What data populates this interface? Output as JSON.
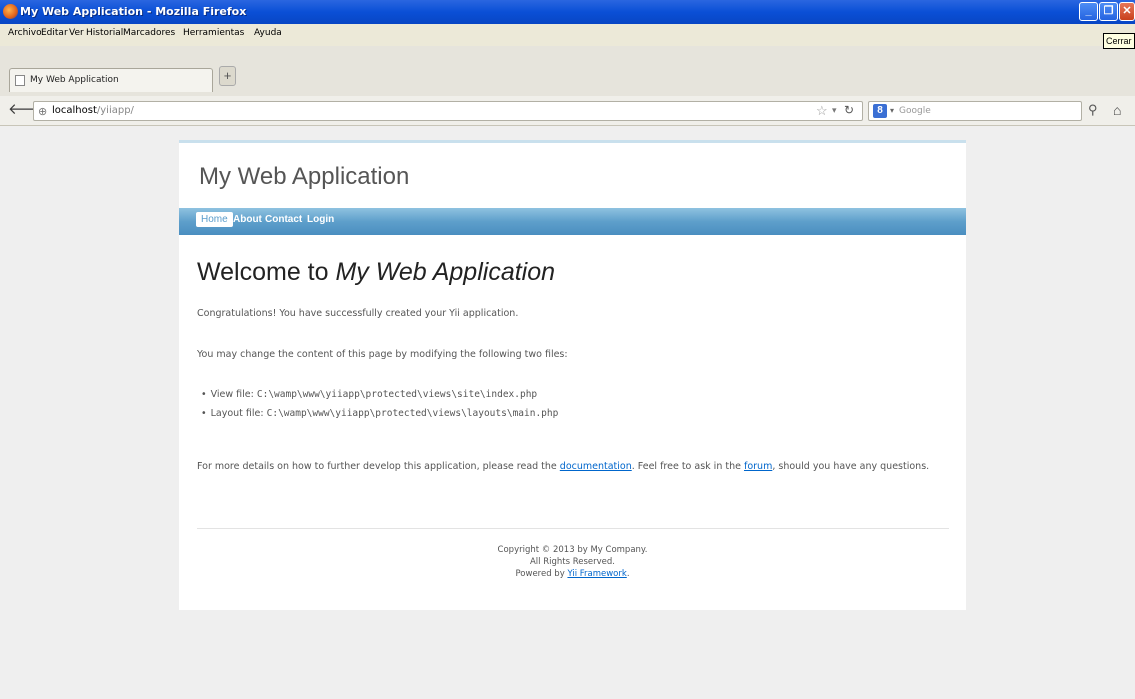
{
  "window": {
    "title": "My Web Application - Mozilla Firefox",
    "close_tooltip": "Cerrar"
  },
  "menubar": {
    "items": [
      "Archivo",
      "Editar",
      "Ver",
      "Historial",
      "Marcadores",
      "Herramientas",
      "Ayuda"
    ]
  },
  "tabs": {
    "active_label": "My Web Application",
    "new_tab": "+"
  },
  "nav": {
    "url_host": "localhost",
    "url_path": "/yiiapp/",
    "search_placeholder": "Google",
    "search_engine_letter": "8"
  },
  "site": {
    "title": "My Web Application",
    "menu": [
      "Home",
      "About",
      "Contact",
      "Login"
    ],
    "heading_prefix": "Welcome to ",
    "heading_emphasis": "My Web Application",
    "congrats": "Congratulations! You have successfully created your Yii application.",
    "change_intro": "You may change the content of this page by modifying the following two files:",
    "view_label": "View file: ",
    "view_path": "C:\\wamp\\www\\yiiapp\\protected\\views\\site\\index.php",
    "layout_label": "Layout file: ",
    "layout_path": "C:\\wamp\\www\\yiiapp\\protected\\views\\layouts\\main.php",
    "more_prefix": "For more details on how to further develop this application, please read the ",
    "documentation_link": "documentation",
    "more_middle": ". Feel free to ask in the ",
    "forum_link": "forum",
    "more_suffix": ", should you have any questions.",
    "footer_copyright": "Copyright © 2013 by My Company.",
    "footer_rights": "All Rights Reserved.",
    "footer_powered": "Powered by ",
    "footer_framework_link": "Yii Framework",
    "footer_period": "."
  },
  "colors": {
    "titlebar": "#0a4fd6",
    "menu_gradient_top": "#8fc2e0",
    "menu_gradient_bottom": "#4a8ec0",
    "link": "#0066cc"
  }
}
